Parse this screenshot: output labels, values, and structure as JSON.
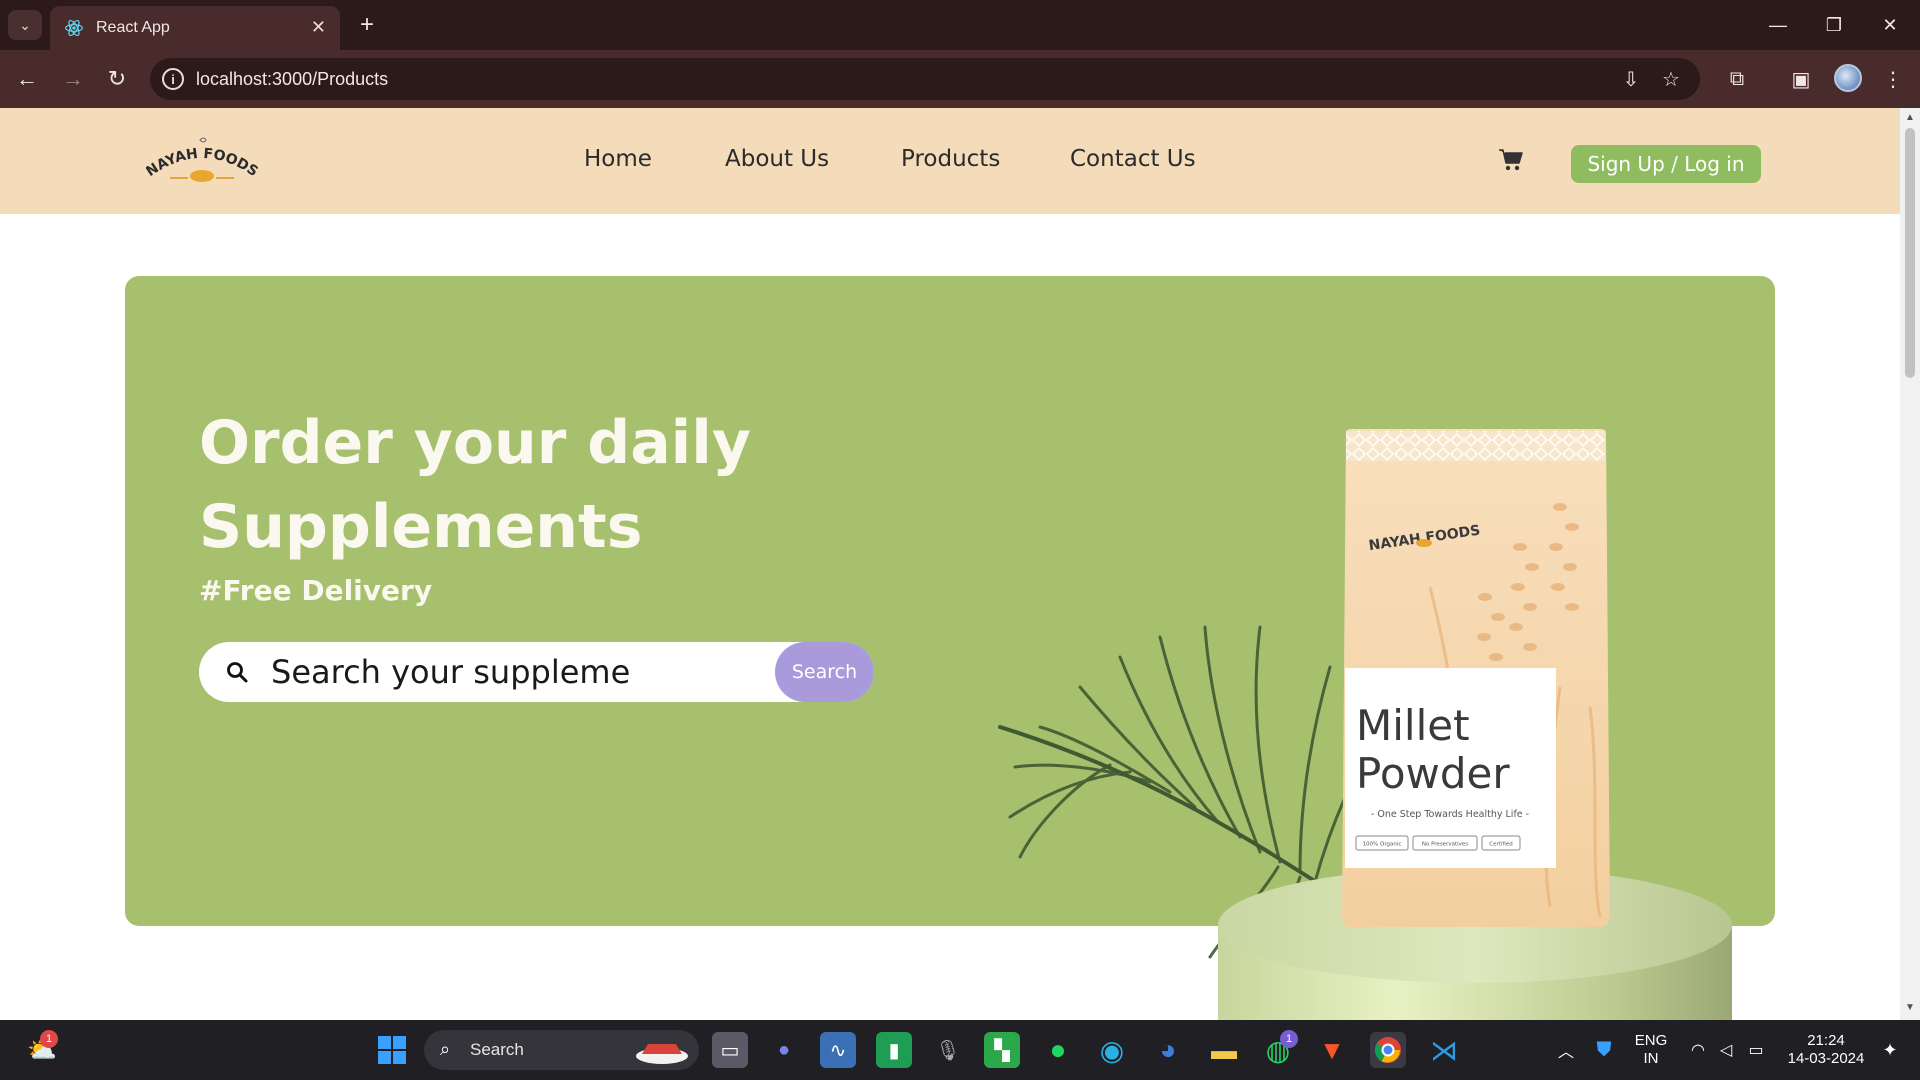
{
  "browser": {
    "tab_title": "React App",
    "url": "localhost:3000/Products"
  },
  "site": {
    "brand": "NAYAH FOODS",
    "nav": [
      "Home",
      "About Us",
      "Products",
      "Contact Us"
    ],
    "signup_label": "Sign Up / Log in"
  },
  "hero": {
    "title_line1": "Order your daily",
    "title_line2": "Supplements",
    "subtitle": "#Free Delivery",
    "search_value": "Search your supplemen",
    "search_button": "Search",
    "product": {
      "name_line1": "Millet",
      "name_line2": "Powder",
      "tagline": "- One Step Towards Healthy Life -",
      "badges": [
        "100% Organic",
        "No Preservatives",
        "Certified"
      ]
    }
  },
  "taskbar": {
    "search_label": "Search",
    "lang_line1": "ENG",
    "lang_line2": "IN",
    "time": "21:24",
    "date": "14-03-2024",
    "weather_badge": "1",
    "whatsapp_badge": "1"
  },
  "colors": {
    "header_bg": "#f4dbba",
    "hero_bg": "#a6c06e",
    "signup_bg": "#8fbc5e",
    "search_btn_bg": "#a89adb",
    "bag_bg": "#f6d7ae"
  }
}
